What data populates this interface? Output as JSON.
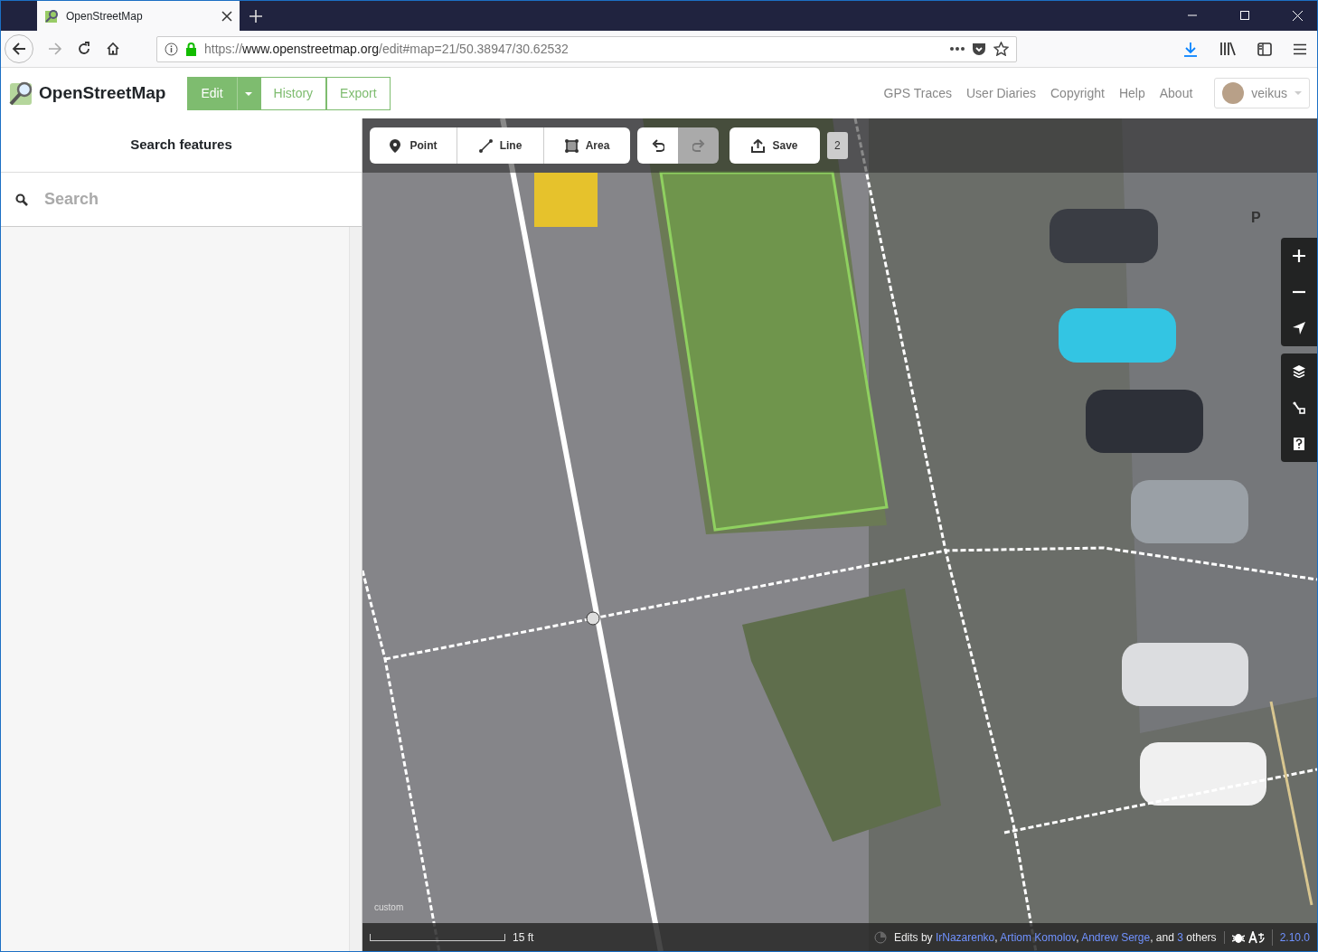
{
  "browser": {
    "tab": {
      "title": "OpenStreetMap"
    },
    "url": {
      "scheme": "https://",
      "domain": "www.openstreetmap.org",
      "path": "/edit#map=21/50.38947/30.62532"
    }
  },
  "header": {
    "brand": "OpenStreetMap",
    "nav_buttons": [
      {
        "label": "Edit",
        "selected": true,
        "dropdown": true
      },
      {
        "label": "History",
        "selected": false,
        "dropdown": false
      },
      {
        "label": "Export",
        "selected": false,
        "dropdown": false
      }
    ],
    "links": [
      "GPS Traces",
      "User Diaries",
      "Copyright",
      "Help",
      "About"
    ],
    "user": {
      "name": "veikus"
    }
  },
  "sidebar": {
    "title": "Search features",
    "search": {
      "placeholder": "Search"
    }
  },
  "toolbar": {
    "modes": [
      {
        "label": "Point",
        "kind": "point"
      },
      {
        "label": "Line",
        "kind": "line"
      },
      {
        "label": "Area",
        "kind": "area"
      }
    ],
    "history": [
      {
        "kind": "undo",
        "disabled": false
      },
      {
        "kind": "redo",
        "disabled": true
      }
    ],
    "save": {
      "label": "Save",
      "count": "2"
    }
  },
  "map": {
    "labels": [
      "P"
    ],
    "imagery": "custom",
    "controls": [
      {
        "kind": "zoom-in"
      },
      {
        "kind": "zoom-out"
      },
      {
        "kind": "locate"
      },
      {
        "kind": "layers"
      },
      {
        "kind": "map-data"
      },
      {
        "kind": "help"
      }
    ]
  },
  "footer": {
    "scale": "15 ft",
    "attribution": [
      {
        "kind": "text",
        "text": "Edits by"
      },
      {
        "kind": "link",
        "text": "IrNazarenko"
      },
      {
        "kind": "text",
        "text": ","
      },
      {
        "kind": "link",
        "text": "Artiom Komolov"
      },
      {
        "kind": "text",
        "text": ","
      },
      {
        "kind": "link",
        "text": "Andrew Serge"
      },
      {
        "kind": "text",
        "text": ", and"
      },
      {
        "kind": "link",
        "text": "3"
      },
      {
        "kind": "text",
        "text": "others"
      }
    ],
    "version": "2.10.0"
  }
}
